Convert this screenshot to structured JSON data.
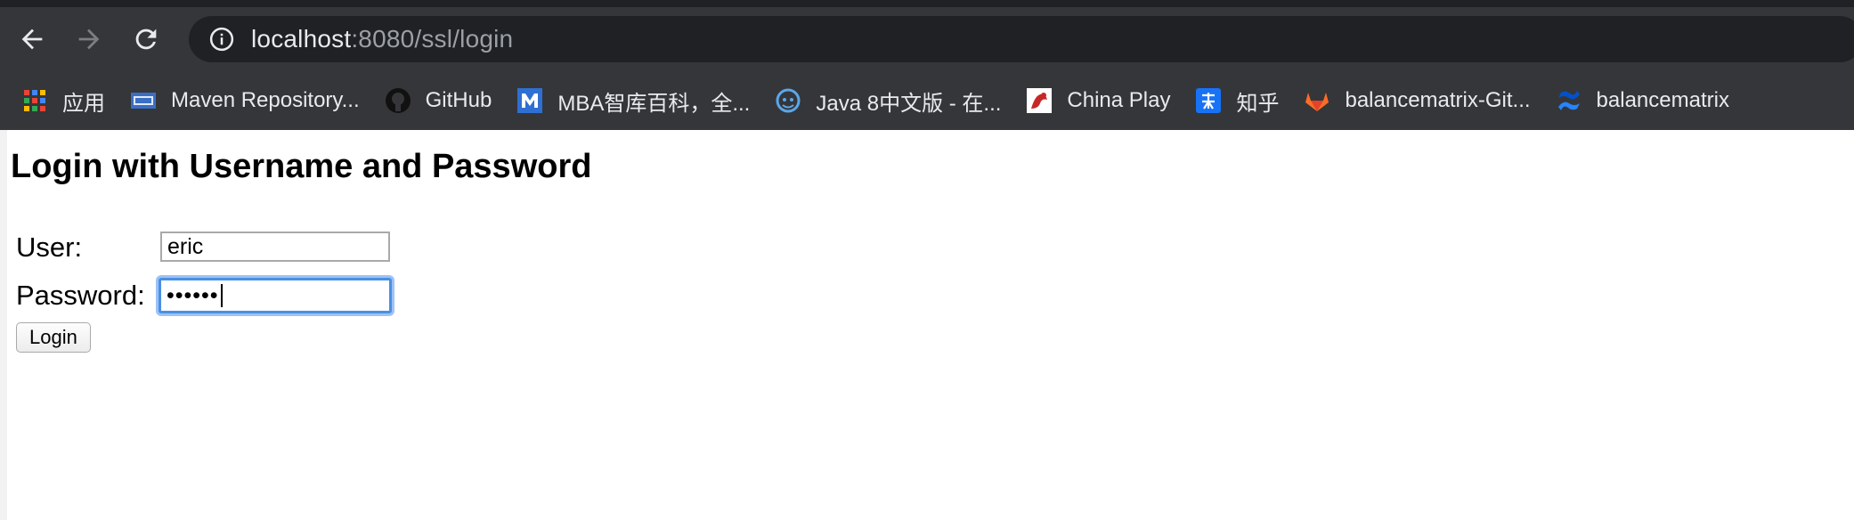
{
  "browser": {
    "url_host": "localhost",
    "url_rest": ":8080/ssl/login",
    "icons": {
      "back": "arrow-left-icon",
      "forward": "arrow-right-icon",
      "reload": "reload-icon",
      "info": "info-icon"
    }
  },
  "bookmarks": [
    {
      "label": "应用",
      "icon": "apps-grid-icon"
    },
    {
      "label": "Maven Repository...",
      "icon": "maven-icon"
    },
    {
      "label": "GitHub",
      "icon": "github-icon"
    },
    {
      "label": "MBA智库百科，全...",
      "icon": "mba-icon"
    },
    {
      "label": "Java 8中文版 - 在...",
      "icon": "java-icon"
    },
    {
      "label": "China Play",
      "icon": "china-play-icon"
    },
    {
      "label": "知乎",
      "icon": "zhihu-icon"
    },
    {
      "label": "balancematrix-Git...",
      "icon": "gitlab-icon"
    },
    {
      "label": "balancematrix",
      "icon": "confluence-icon"
    }
  ],
  "page": {
    "title": "Login with Username and Password",
    "user_label": "User:",
    "user_value": "eric",
    "password_label": "Password:",
    "password_value": "••••••",
    "login_label": "Login"
  },
  "colors": {
    "toolbar": "#35363a",
    "omnibox": "#202124",
    "focus_ring": "#4a90e2"
  }
}
